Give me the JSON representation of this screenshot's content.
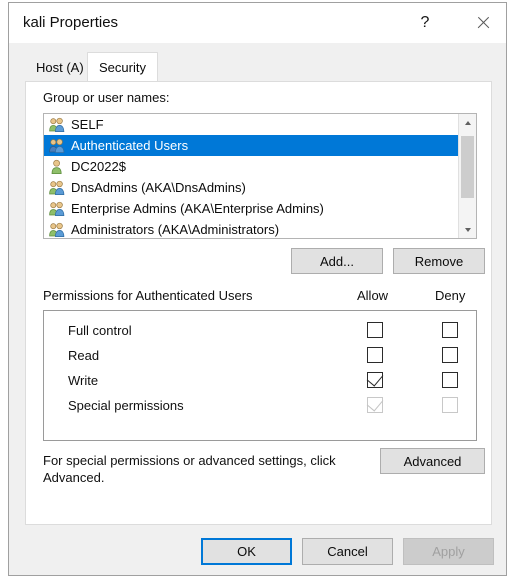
{
  "window": {
    "title": "kali Properties",
    "help_icon": "question-mark-icon",
    "close_icon": "close-icon"
  },
  "tabs": [
    {
      "label": "Host (A)",
      "active": false
    },
    {
      "label": "Security",
      "active": true
    }
  ],
  "group_list": {
    "label": "Group or user names:",
    "items": [
      {
        "name": "SELF",
        "icon": "group-icon",
        "selected": false
      },
      {
        "name": "Authenticated Users",
        "icon": "group-icon",
        "selected": true
      },
      {
        "name": "DC2022$",
        "icon": "user-icon",
        "selected": false
      },
      {
        "name": "DnsAdmins (AKA\\DnsAdmins)",
        "icon": "group-icon",
        "selected": false
      },
      {
        "name": "Enterprise Admins (AKA\\Enterprise Admins)",
        "icon": "group-icon",
        "selected": false
      },
      {
        "name": "Administrators (AKA\\Administrators)",
        "icon": "group-icon",
        "selected": false
      }
    ],
    "scroll_up_icon": "chevron-up-icon",
    "scroll_down_icon": "chevron-down-icon"
  },
  "list_buttons": {
    "add": "Add...",
    "remove": "Remove"
  },
  "permissions": {
    "title": "Permissions for Authenticated Users",
    "columns": {
      "allow": "Allow",
      "deny": "Deny"
    },
    "rows": [
      {
        "name": "Full control",
        "allow": false,
        "deny": false,
        "allow_disabled": false,
        "deny_disabled": false
      },
      {
        "name": "Read",
        "allow": false,
        "deny": false,
        "allow_disabled": false,
        "deny_disabled": false
      },
      {
        "name": "Write",
        "allow": true,
        "deny": false,
        "allow_disabled": false,
        "deny_disabled": false
      },
      {
        "name": "Special permissions",
        "allow": true,
        "deny": false,
        "allow_disabled": true,
        "deny_disabled": true
      }
    ]
  },
  "advanced": {
    "hint": "For special permissions or advanced settings, click Advanced.",
    "button": "Advanced"
  },
  "footer_buttons": {
    "ok": "OK",
    "cancel": "Cancel",
    "apply": "Apply"
  },
  "colors": {
    "selection": "#0078d7",
    "dialog_bg": "#f0f0f0",
    "panel_bg": "#ffffff",
    "button_bg": "#e1e1e1"
  }
}
